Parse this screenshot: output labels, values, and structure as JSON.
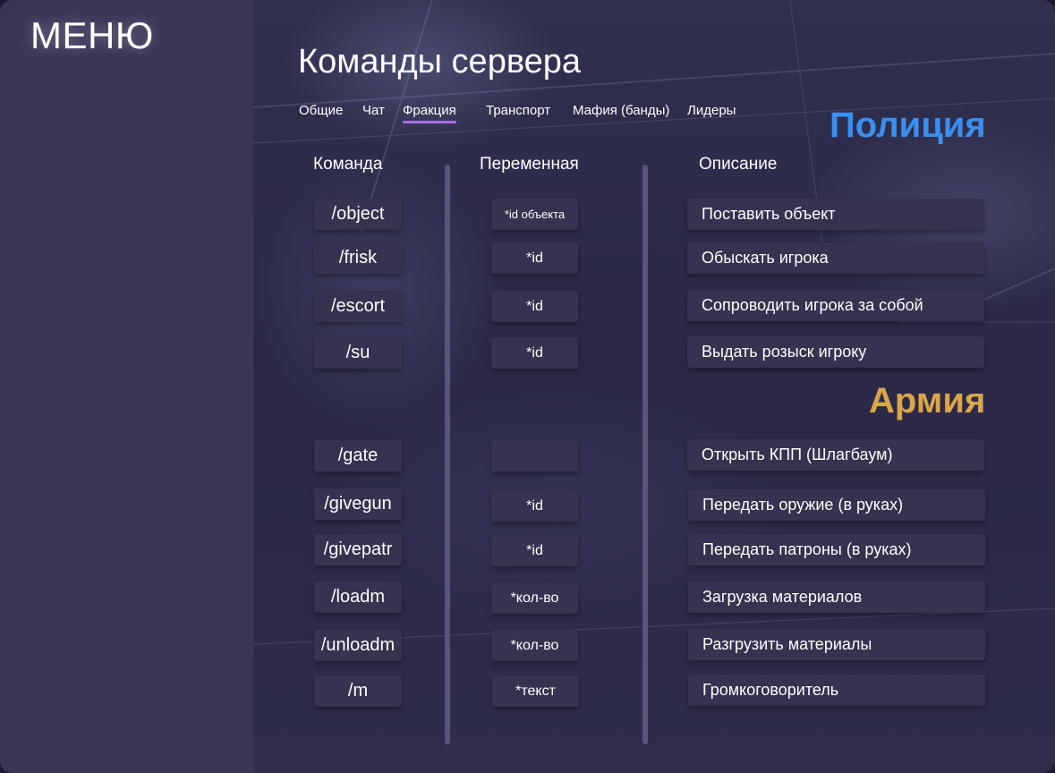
{
  "sidebar": {
    "title": "МЕНЮ"
  },
  "page_title": "Команды сервера",
  "tabs": [
    {
      "label": "Общие",
      "active": false
    },
    {
      "label": "Чат",
      "active": false
    },
    {
      "label": "Фракция",
      "active": true
    },
    {
      "label": "Транспорт",
      "active": false
    },
    {
      "label": "Мафия (банды)",
      "active": false
    },
    {
      "label": "Лидеры",
      "active": false
    }
  ],
  "columns": {
    "command": "Команда",
    "variable": "Переменная",
    "description": "Описание"
  },
  "factions": {
    "police": {
      "title": "Полиция",
      "color": "#3a8ff0",
      "rows": [
        {
          "command": "/object",
          "variable": "*id объекта",
          "description": "Поставить объект"
        },
        {
          "command": "/frisk",
          "variable": "*id",
          "description": "Обыскать игрока"
        },
        {
          "command": "/escort",
          "variable": "*id",
          "description": "Сопроводить игрока за собой"
        },
        {
          "command": "/su",
          "variable": "*id",
          "description": "Выдать розыск игроку"
        }
      ]
    },
    "army": {
      "title": "Армия",
      "color": "#d9a64a",
      "rows": [
        {
          "command": "/gate",
          "variable": "",
          "description": "Открыть КПП (Шлагбаум)"
        },
        {
          "command": "/givegun",
          "variable": "*id",
          "description": "Передать оружие (в руках)"
        },
        {
          "command": "/givepatr",
          "variable": "*id",
          "description": "Передать патроны (в руках)"
        },
        {
          "command": "/loadm",
          "variable": "*кол-во",
          "description": "Загрузка материалов"
        },
        {
          "command": "/unloadm",
          "variable": "*кол-во",
          "description": "Разгрузить материалы"
        },
        {
          "command": "/m",
          "variable": "*текст",
          "description": "Громкоговоритель"
        }
      ]
    }
  },
  "colors": {
    "accent_underline": "#a56de8",
    "sidebar_bg": "#3b3658",
    "cell_bg": "#36324f"
  }
}
